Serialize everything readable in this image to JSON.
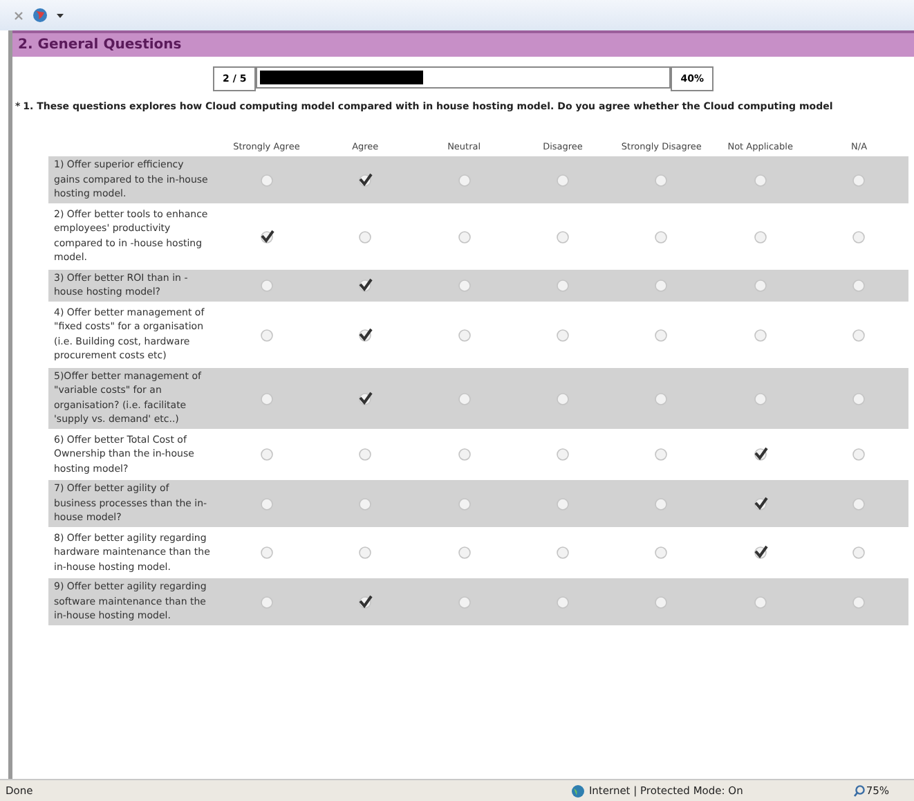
{
  "section": {
    "title": "2. General Questions"
  },
  "progress": {
    "page": "2 / 5",
    "level": 0.4,
    "percent": "40%"
  },
  "question": {
    "marker": "*",
    "text": "1. These questions explores how Cloud computing model compared with in house hosting model. Do you agree whether the Cloud computing model"
  },
  "columns": [
    "Strongly Agree",
    "Agree",
    "Neutral",
    "Disagree",
    "Strongly Disagree",
    "Not Applicable",
    "N/A"
  ],
  "rows": [
    {
      "label": "1) Offer superior efficiency gains compared to the in-house hosting model.",
      "choices": [
        {
          "selected": false
        },
        {
          "selected": true
        },
        {
          "selected": false
        },
        {
          "selected": false
        },
        {
          "selected": false
        },
        {
          "selected": false
        },
        {
          "selected": false
        }
      ]
    },
    {
      "label": "2) Offer better tools to enhance employees' productivity compared to in -house hosting model.",
      "choices": [
        {
          "selected": true
        },
        {
          "selected": false
        },
        {
          "selected": false
        },
        {
          "selected": false
        },
        {
          "selected": false
        },
        {
          "selected": false
        },
        {
          "selected": false
        }
      ]
    },
    {
      "label": "3) Offer better ROI than in -house hosting model?",
      "choices": [
        {
          "selected": false
        },
        {
          "selected": true
        },
        {
          "selected": false
        },
        {
          "selected": false
        },
        {
          "selected": false
        },
        {
          "selected": false
        },
        {
          "selected": false
        }
      ]
    },
    {
      "label": "4) Offer better management of \"fixed costs\" for a organisation (i.e. Building cost, hardware procurement costs etc)",
      "choices": [
        {
          "selected": false
        },
        {
          "selected": true
        },
        {
          "selected": false
        },
        {
          "selected": false
        },
        {
          "selected": false
        },
        {
          "selected": false
        },
        {
          "selected": false
        }
      ]
    },
    {
      "label": "5)Offer better management of \"variable costs\" for an organisation? (i.e. facilitate 'supply vs. demand' etc..)",
      "choices": [
        {
          "selected": false
        },
        {
          "selected": true
        },
        {
          "selected": false
        },
        {
          "selected": false
        },
        {
          "selected": false
        },
        {
          "selected": false
        },
        {
          "selected": false
        }
      ]
    },
    {
      "label": "6) Offer better Total Cost of Ownership than the in-house hosting model?",
      "choices": [
        {
          "selected": false
        },
        {
          "selected": false
        },
        {
          "selected": false
        },
        {
          "selected": false
        },
        {
          "selected": false
        },
        {
          "selected": true
        },
        {
          "selected": false
        }
      ]
    },
    {
      "label": "7) Offer better agility of business processes than the in-house model?",
      "choices": [
        {
          "selected": false
        },
        {
          "selected": false
        },
        {
          "selected": false
        },
        {
          "selected": false
        },
        {
          "selected": false
        },
        {
          "selected": true
        },
        {
          "selected": false
        }
      ]
    },
    {
      "label": "8) Offer better agility regarding hardware maintenance than the in-house hosting model.",
      "choices": [
        {
          "selected": false
        },
        {
          "selected": false
        },
        {
          "selected": false
        },
        {
          "selected": false
        },
        {
          "selected": false
        },
        {
          "selected": true
        },
        {
          "selected": false
        }
      ]
    },
    {
      "label": "9) Offer better agility regarding software maintenance than the in-house hosting model.",
      "choices": [
        {
          "selected": false
        },
        {
          "selected": true
        },
        {
          "selected": false
        },
        {
          "selected": false
        },
        {
          "selected": false
        },
        {
          "selected": false
        },
        {
          "selected": false
        }
      ]
    }
  ],
  "status_bar": {
    "text": "Done",
    "zone": "Internet | Protected Mode: On",
    "zoom": "75%"
  }
}
